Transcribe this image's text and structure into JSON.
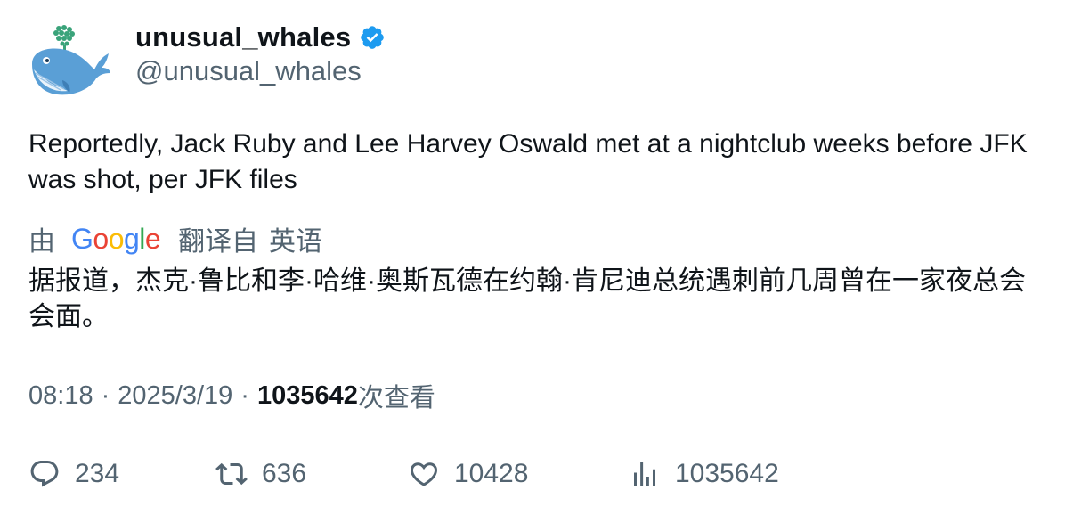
{
  "author": {
    "display_name": "unusual_whales",
    "handle": "@unusual_whales",
    "verified": true,
    "avatar_icon": "whale-logo"
  },
  "tweet": {
    "text": "Reportedly, Jack Ruby and Lee Harvey Oswald met at a nightclub weeks before JFK was shot, per JFK files"
  },
  "translation": {
    "by_label": "由",
    "provider_logo_text": "Google",
    "translated_from_label": "翻译自",
    "source_language": "英语",
    "translated_text": "据报道，杰克·鲁比和李·哈维·奥斯瓦德在约翰·肯尼迪总统遇刺前几周曾在一家夜总会会面。"
  },
  "meta": {
    "time": "08:18",
    "separator": "·",
    "date": "2025/3/19",
    "views_count": "1035642",
    "views_suffix": "次查看"
  },
  "actions": {
    "replies": "234",
    "retweets": "636",
    "likes": "10428",
    "views": "1035642"
  },
  "colors": {
    "text_primary": "#0f1419",
    "text_secondary": "#536471",
    "verified_blue": "#1d9bf0",
    "google_blue": "#4285F4",
    "google_red": "#EA4335",
    "google_yellow": "#FBBC05",
    "google_green": "#34A853"
  }
}
